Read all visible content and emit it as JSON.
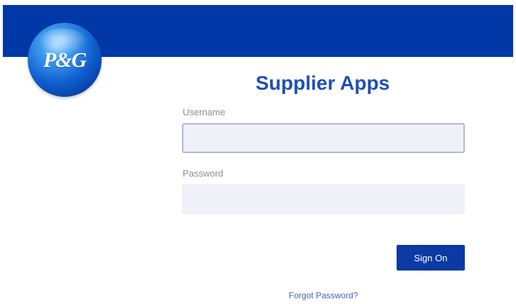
{
  "brand": {
    "logo_text": "P&G",
    "primary_color": "#0138a8",
    "title_color": "#1f4fb5"
  },
  "login": {
    "title": "Supplier Apps",
    "username_label": "Username",
    "username_value": "",
    "password_label": "Password",
    "password_value": "",
    "sign_on_label": "Sign On",
    "forgot_password_label": "Forgot Password?"
  }
}
